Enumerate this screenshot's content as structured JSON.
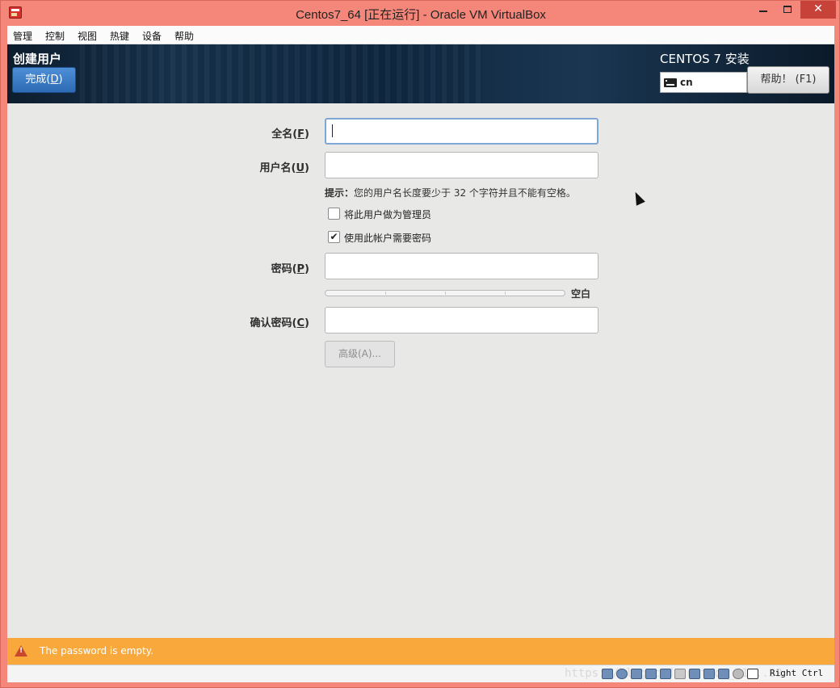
{
  "window": {
    "title": "Centos7_64 [正在运行] - Oracle VM VirtualBox",
    "minimize_glyph": "",
    "close_glyph": "✕"
  },
  "menubar": {
    "items": [
      "管理",
      "控制",
      "视图",
      "热键",
      "设备",
      "帮助"
    ]
  },
  "header": {
    "page_title": "创建用户",
    "done_label": "完成(",
    "done_mnemonic": "D",
    "done_suffix": ")",
    "install_title": "CENTOS 7 安装",
    "keyboard_layout": "cn",
    "help_label": "帮助！ (F1)"
  },
  "form": {
    "fullname_label": "全名(",
    "fullname_mnemonic": "F",
    "username_label": "用户名(",
    "username_mnemonic": "U",
    "label_close": ")",
    "hint_bold": "提示：",
    "hint_text": "您的用户名长度要少于 32 个字符并且不能有空格。",
    "admin_label": "将此用户做为管理员",
    "admin_checked": false,
    "require_password_label": "使用此帐户需要密码",
    "require_password_checked": true,
    "check_glyph": "✔",
    "password_label": "密码(",
    "password_mnemonic": "P",
    "strength_label": "空白",
    "strength_level": 0,
    "confirm_label": "确认密码(",
    "confirm_mnemonic": "C",
    "advanced_label": "高级(A)...",
    "fullname_value": "",
    "username_value": "",
    "password_value": "",
    "confirm_value": ""
  },
  "warning": {
    "text": "The password is empty."
  },
  "statusbar": {
    "watermark": "https://blog.csdn.net/qq_41...39",
    "host_key": "Right Ctrl"
  }
}
